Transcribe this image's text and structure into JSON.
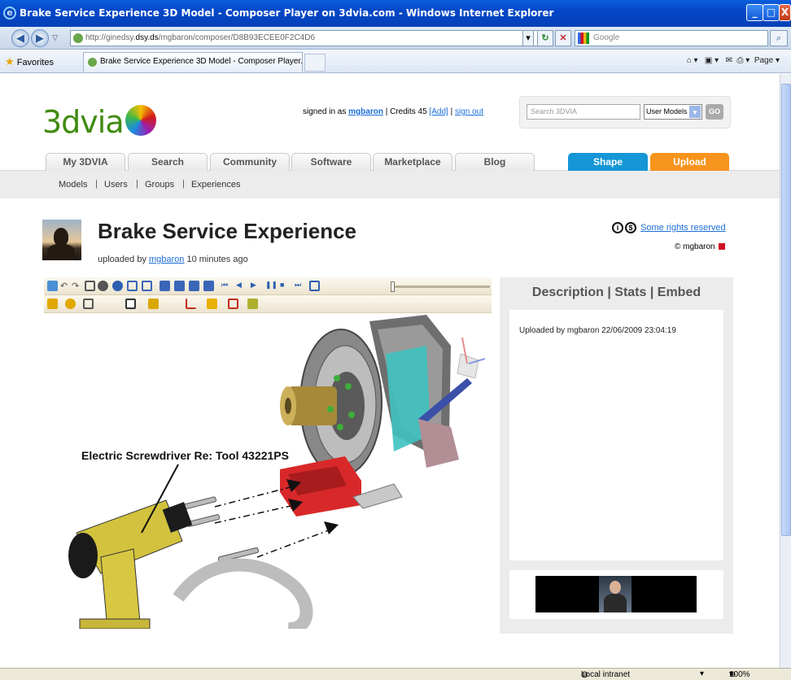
{
  "window": {
    "title": "Brake Service Experience 3D Model - Composer Player on 3dvia.com - Windows Internet Explorer"
  },
  "addressbar": {
    "url_prefix": "http://ginedsy.",
    "url_domain": "dsy.ds",
    "url_rest": "/mgbaron/composer/D8B93ECEE0F2C4D6",
    "search_placeholder": "Google"
  },
  "favoritesbar": {
    "favorites_label": "Favorites",
    "tab_label": "Brake Service Experience 3D Model - Composer Player...",
    "page_menu": "Page"
  },
  "site": {
    "logo_text": "3dvia",
    "signed_in_prefix": "signed in as ",
    "username": "mgbaron",
    "credits_text": " | Credits 45 ",
    "add_link": "[Add]",
    "sep": " | ",
    "signout_link": "sign out",
    "search_placeholder": "Search 3DVIA",
    "search_scope": "User Models",
    "go_label": "GO"
  },
  "nav": {
    "tabs": [
      "My 3DVIA",
      "Search",
      "Community",
      "Software",
      "Marketplace",
      "Blog"
    ],
    "shape_label": "Shape",
    "upload_label": "Upload",
    "sub": [
      "Models",
      "Users",
      "Groups",
      "Experiences"
    ]
  },
  "model": {
    "title": "Brake Service Experience",
    "uploaded_prefix": "uploaded by ",
    "uploader": "mgbaron",
    "uploaded_suffix": " 10 minutes ago",
    "rights_link": "Some rights reserved",
    "owner": "© mgbaron",
    "annotation": "Electric Screwdriver Re: Tool 43221PS"
  },
  "panel": {
    "title": "Description | Stats | Embed",
    "description": "Uploaded by mgbaron 22/06/2009 23:04:19"
  },
  "statusbar": {
    "zone": "Local intranet",
    "zoom": "100%"
  }
}
